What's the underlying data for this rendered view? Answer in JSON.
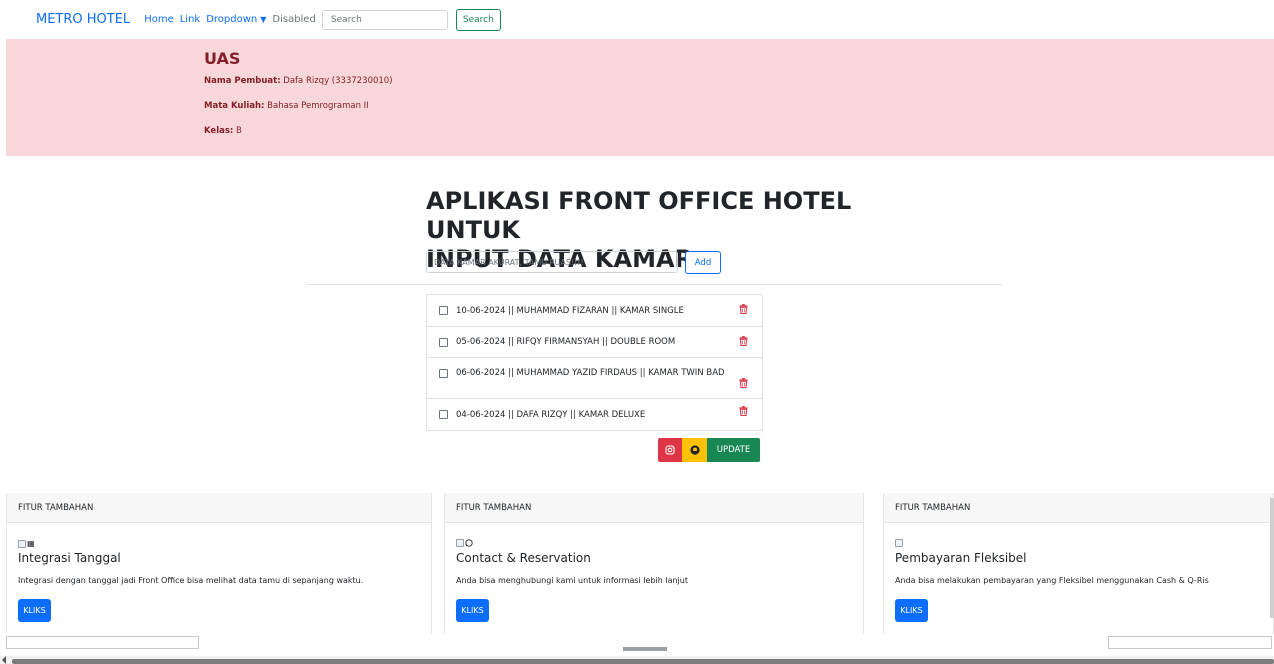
{
  "navbar": {
    "brand": "METRO HOTEL",
    "links": [
      "Home",
      "Link",
      "Dropdown",
      "Disabled"
    ],
    "search_placeholder": "Search",
    "search_button": "Search"
  },
  "alert": {
    "title": "UAS",
    "rows": [
      {
        "label": "Nama Pembuat:",
        "value": " Dafa Rizqy (3337230010)"
      },
      {
        "label": "Mata Kuliah:",
        "value": " Bahasa Pemrograman II"
      },
      {
        "label": "Kelas:",
        "value": " B"
      }
    ]
  },
  "main": {
    "heading_line1": "APLIKASI FRONT OFFICE HOTEL UNTUK",
    "heading_line2": "INPUT DATA KAMAR",
    "input_placeholder": "DATA KAMAR AKURAT, TAMU PUAS!!!!",
    "add_button": "Add"
  },
  "todos": [
    "10-06-2024 || MUHAMMAD FIZARAN || KAMAR SINGLE",
    "05-06-2024 || RIFQY FIRMANSYAH || DOUBLE ROOM",
    "06-06-2024 || MUHAMMAD YAZID FIRDAUS || KAMAR TWIN BAD",
    "04-06-2024 || DAFA RIZQY || KAMAR DELUXE"
  ],
  "actions": {
    "instagram_icon": "instagram-icon",
    "github_icon": "github-icon",
    "update": "UPDATE"
  },
  "cards": [
    {
      "header": "FITUR TAMBAHAN",
      "icon": "calendar-icon",
      "title": "Integrasi Tanggal",
      "text": "Integrasi dengan tanggal jadi Front Office bisa melihat data tamu di sepanjang waktu.",
      "button": "KLIKS"
    },
    {
      "header": "FITUR TAMBAHAN",
      "icon": "whatsapp-icon",
      "title": "Contact & Reservation",
      "text": "Anda bisa menghubungi kami untuk informasi lebih lanjut",
      "button": "KLIKS"
    },
    {
      "header": "FITUR TAMBAHAN",
      "icon": "image-icon",
      "title": "Pembayaran Fleksibel",
      "text": "Anda bisa melakukan pembayaran yang Fleksibel menggunakan Cash & Q-Ris",
      "button": "KLIKS"
    }
  ],
  "carousel": {
    "alt": "..."
  },
  "colors": {
    "primary": "#0d6efd",
    "success": "#198754",
    "danger": "#dc3545",
    "warning": "#ffc107",
    "alert_bg": "#f8d7da",
    "alert_text": "#842029"
  }
}
